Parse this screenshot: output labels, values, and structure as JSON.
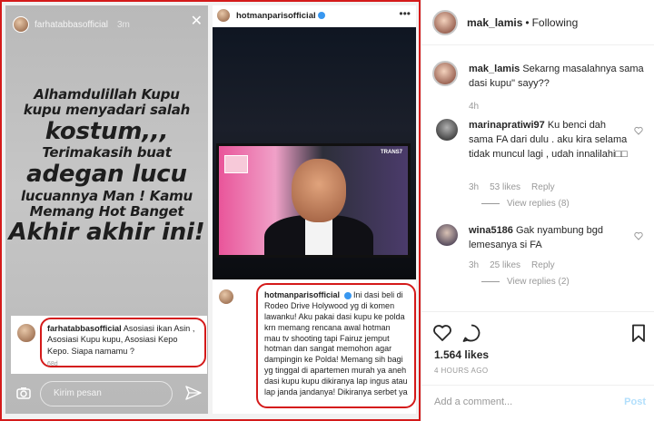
{
  "story": {
    "username": "farhatabbasofficial",
    "time": "3m",
    "lines": [
      {
        "text": "Alhamdulillah Kupu",
        "size": "md"
      },
      {
        "text": "kupu menyadari salah",
        "size": "md"
      },
      {
        "text": "kostum,,,",
        "size": "lg"
      },
      {
        "text": "Terimakasih buat",
        "size": "md"
      },
      {
        "text": "adegan lucu",
        "size": "lg"
      },
      {
        "text": "lucuannya Man ! Kamu",
        "size": "md"
      },
      {
        "text": "Memang Hot Banget",
        "size": "md"
      },
      {
        "text": "Akhir akhir ini!",
        "size": "lg"
      }
    ],
    "comment": {
      "username": "farhatabbasofficial",
      "text": "Asosiasi ikan Asin , Asosiasi Kupu kupu, Asosiasi Kepo Kepo. Siapa namamu ?",
      "time": "68d"
    },
    "message_placeholder": "Kirim pesan"
  },
  "post": {
    "username": "hotmanparisofficial",
    "comment": {
      "username": "hotmanparisofficial",
      "text": "Ini dasi beli di Rodeo Drive Holywood yg di komen lawanku! Aku pakai dasi kupu ke polda krn memang rencana awal hotman mau tv shooting tapi Fairuz jemput hotman dan sangat memohon agar dampingin ke Polda! Memang sih bagi yg tinggal di apartemen murah ya aneh dasi kupu kupu dikiranya lap ingus atau lap janda jandanya! Dikiranya serbet ya"
    },
    "tv_logo": "TRANS7"
  },
  "right": {
    "header": {
      "username": "mak_lamis",
      "status": "Following"
    },
    "caption": {
      "username": "mak_lamis",
      "text": "Sekarng masalahnya sama dasi kupu\" sayy??",
      "time": "4h"
    },
    "comments": [
      {
        "username": "marinapratiwi97",
        "text": "Ku benci dah sama FA dari dulu . aku kira selama tidak muncul lagi , udah innalilahi□□",
        "time": "3h",
        "likes": "53 likes",
        "reply": "Reply",
        "view_replies": "View replies (8)"
      },
      {
        "username": "wina5186",
        "text": "Gak nyambung bgd lemesanya si FA",
        "time": "3h",
        "likes": "25 likes",
        "reply": "Reply",
        "view_replies": "View replies (2)"
      }
    ],
    "likes_count": "1.564 likes",
    "posted_ago": "4 HOURS AGO",
    "add_comment_placeholder": "Add a comment...",
    "post_label": "Post"
  },
  "colors": {
    "highlight": "#d41a1a",
    "link_blue": "#3897f0"
  },
  "icons": [
    "close-icon",
    "camera-icon",
    "send-icon",
    "more-icon",
    "heart-icon",
    "comment-icon",
    "bookmark-icon",
    "verified-icon"
  ]
}
